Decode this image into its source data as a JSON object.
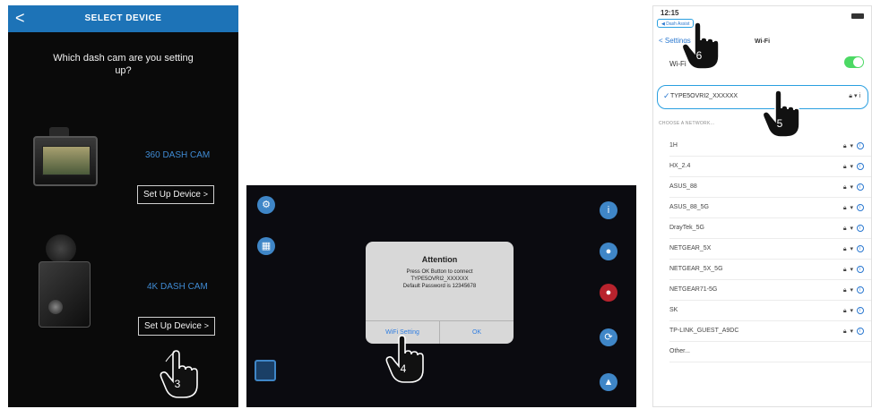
{
  "panel1": {
    "back_glyph": "<",
    "title": "SELECT DEVICE",
    "question": "Which dash cam are you setting up?",
    "devices": [
      {
        "name": "360 DASH CAM",
        "button": "Set Up Device",
        "chevron": ">"
      },
      {
        "name": "4K DASH CAM",
        "button": "Set Up Device",
        "chevron": ">"
      }
    ],
    "step": "3"
  },
  "panel2": {
    "dialog_title": "Attention",
    "dialog_lines": [
      "Press OK Button to connect",
      "TYPE5OVRI2_XXXXXX",
      "Default Password is 12345678"
    ],
    "actions": [
      "WiFi Setting",
      "OK"
    ],
    "step": "4"
  },
  "panel3": {
    "status_time": "12:15",
    "prev_app": "◀ Dash Assist",
    "nav_back": "< Settings",
    "nav_title": "Wi-Fi",
    "wifi_label": "Wi-Fi",
    "connected_network": "TYPE5OVRI2_XXXXXX",
    "section_label": "CHOOSE A NETWORK...",
    "networks": [
      "1H",
      "HX_2.4",
      "ASUS_88",
      "ASUS_88_5G",
      "DrayTek_5G",
      "NETGEAR_5X",
      "NETGEAR_5X_5G",
      "NETGEAR71-5G",
      "SK",
      "TP-LINK_GUEST_A9DC",
      "Other..."
    ],
    "step_back": "6",
    "step_network": "5"
  },
  "colors": {
    "header_blue": "#1d73b7",
    "accent_blue": "#3f86c7",
    "ios_blue": "#2a78d0",
    "toggle_green": "#4cd964",
    "alert_red": "#b8232d"
  }
}
